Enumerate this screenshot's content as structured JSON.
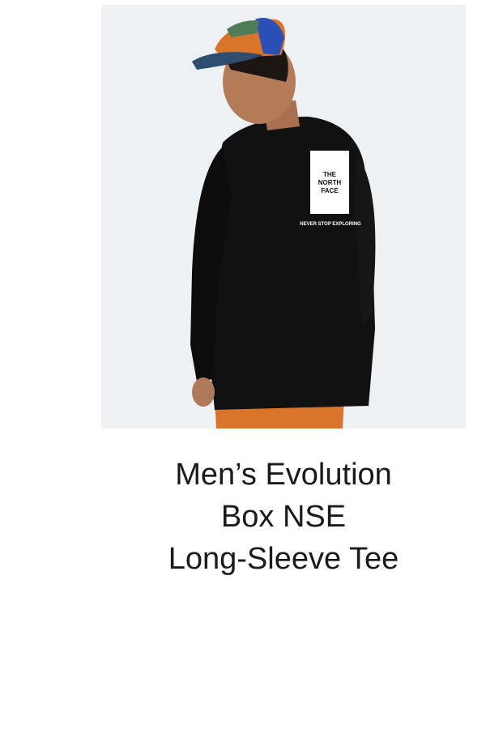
{
  "product": {
    "image": {
      "icon": "model-wearing-long-sleeve-tee-image",
      "logo_text": [
        "THE",
        "NORTH",
        "FACE"
      ],
      "back_print": "NEVER STOP EXPLORING"
    },
    "title_lines": [
      "Men’s Evolution",
      "Box NSE",
      "Long-Sleeve Tee"
    ]
  },
  "colors": {
    "background": "#ffffff",
    "image_bg": "#eef1f4",
    "shirt": "#111111",
    "pants": "#d9742a",
    "text": "#1a1a1a"
  }
}
